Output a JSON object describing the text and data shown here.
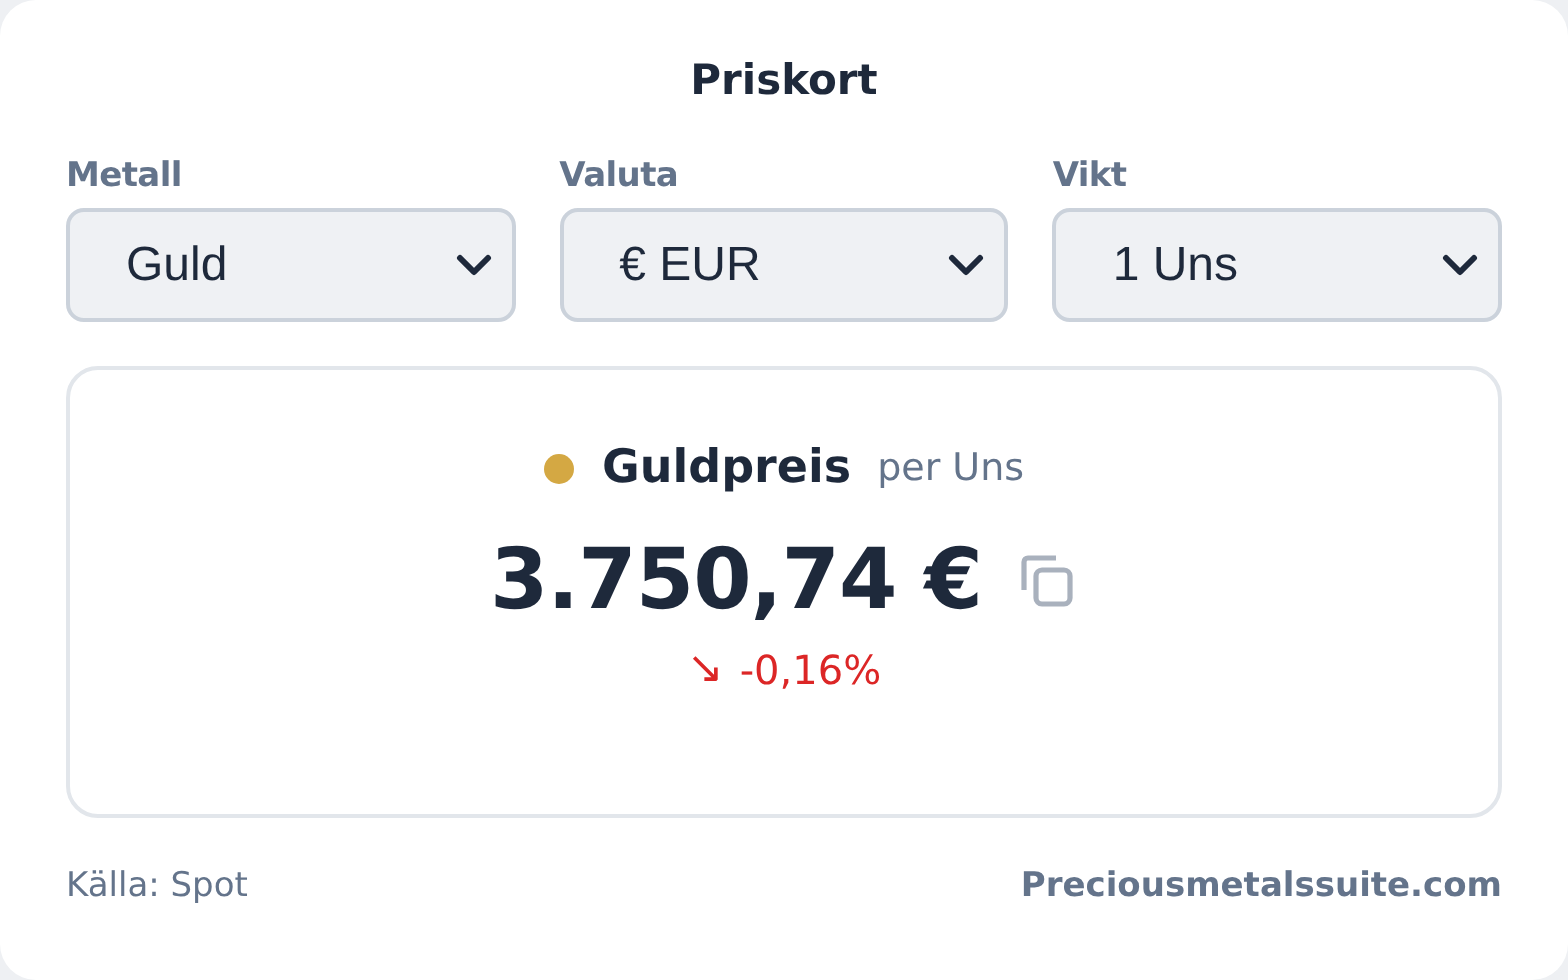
{
  "title": "Priskort",
  "selectors": [
    {
      "label": "Metall",
      "value": "Guld"
    },
    {
      "label": "Valuta",
      "value": "€ EUR"
    },
    {
      "label": "Vikt",
      "value": "1 Uns"
    }
  ],
  "price": {
    "metal": "Guldpreis",
    "color": "#d4a843",
    "unit": "per Uns",
    "amount": "3.750,74 €",
    "arrow": "↘",
    "change": "-0,16%"
  },
  "footer": {
    "source": "Källa: Spot",
    "site": "Preciousmetalssuite.com"
  }
}
